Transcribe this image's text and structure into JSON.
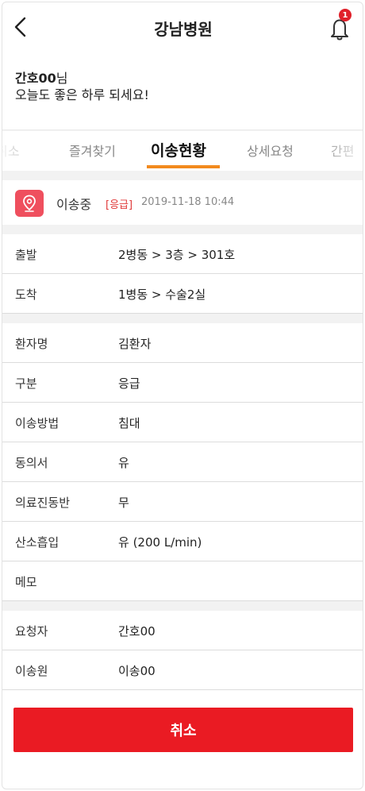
{
  "header": {
    "title": "강남병원",
    "notification_count": "1"
  },
  "greeting": {
    "name": "간호00",
    "suffix": "님",
    "message": "오늘도 좋은 하루 되세요!"
  },
  "tabs": [
    {
      "label": "취소"
    },
    {
      "label": "즐겨찾기"
    },
    {
      "label": "이송현황",
      "active": true
    },
    {
      "label": "상세요청"
    },
    {
      "label": "간편"
    }
  ],
  "status": {
    "text": "이송중",
    "urgency": "[응급]",
    "datetime": "2019-11-18 10:44",
    "accent": "#ef4f5e"
  },
  "route": [
    {
      "label": "출발",
      "value": "2병동 > 3층 > 301호"
    },
    {
      "label": "도착",
      "value": "1병동 > 수술2실"
    }
  ],
  "patient": [
    {
      "label": "환자명",
      "value": "김환자"
    },
    {
      "label": "구분",
      "value": "응급"
    },
    {
      "label": "이송방법",
      "value": "침대"
    },
    {
      "label": "동의서",
      "value": "유"
    },
    {
      "label": "의료진동반",
      "value": "무"
    },
    {
      "label": "산소흡입",
      "value": "유 (200 L/min)"
    },
    {
      "label": "메모",
      "value": ""
    }
  ],
  "staff": [
    {
      "label": "요청자",
      "value": "간호00"
    },
    {
      "label": "이송원",
      "value": "이송00"
    }
  ],
  "actions": {
    "cancel_label": "취소",
    "cancel_color": "#ea1b23"
  }
}
